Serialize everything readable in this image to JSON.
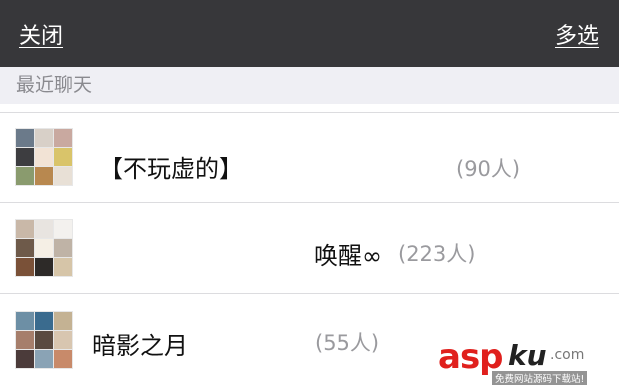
{
  "navbar": {
    "close_label": "关闭",
    "multiselect_label": "多选"
  },
  "section": {
    "title": "最近聊天"
  },
  "chats": [
    {
      "name": "【不玩虚的】",
      "count": "(90人)"
    },
    {
      "name": "唤醒∞",
      "count": "(223人)"
    },
    {
      "name": "暗影之月",
      "count": "(55人)"
    }
  ],
  "watermark": {
    "brand": "asp",
    "suffix": "ku",
    "domain": ".com",
    "subtitle": "免费网站源码下载站!"
  },
  "avatar_colors": [
    [
      "#6b7a8a",
      "#d8d0c8",
      "#c9a9a0",
      "#3d3d40",
      "#f2e3d5",
      "#d9c46a",
      "#8a9b6e",
      "#b8884f",
      "#e8e0d6"
    ],
    [
      "#c9b8a8",
      "#e8e4e0",
      "#f3f1ee",
      "#6e5a4a",
      "#f5efe5",
      "#bfb3a6",
      "#7a5138",
      "#2d2a28",
      "#d6c5a8"
    ],
    [
      "#6d8fa5",
      "#3a6b8e",
      "#c4b293",
      "#a67e6b",
      "#5a4a40",
      "#d8c6b0",
      "#4b3b3a",
      "#8aa3b5",
      "#c88a6a"
    ]
  ]
}
